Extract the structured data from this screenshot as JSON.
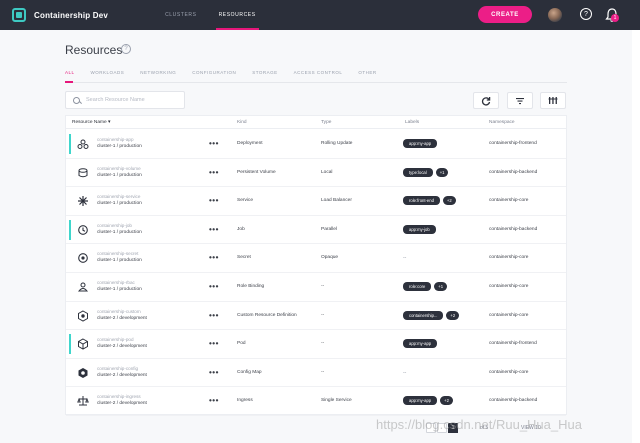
{
  "topbar": {
    "brand": "Containership Dev",
    "nav": [
      "CLUSTERS",
      "RESOURCES"
    ],
    "active_nav": 1,
    "create_label": "CREATE",
    "help_glyph": "?",
    "notification_count": "1",
    "accent": "#ec1e87"
  },
  "page": {
    "title": "Resources",
    "help_glyph": "?"
  },
  "tabs": [
    "ALL",
    "WORKLOADS",
    "NETWORKING",
    "CONFIGURATION",
    "STORAGE",
    "ACCESS CONTROL",
    "OTHER"
  ],
  "search": {
    "placeholder": "Search Resource Name"
  },
  "toolbar": {
    "refresh_icon": "refresh-icon",
    "filter_icon": "filter-icon",
    "columns_icon": "columns-icon"
  },
  "table": {
    "headers": {
      "name": "Resource Name",
      "kind": "Kind",
      "type": "Type",
      "labels": "Labels",
      "namespace": "Namespace"
    },
    "rows": [
      {
        "name": "containership-app",
        "cluster": "cluster-1 / production",
        "kind": "Deployment",
        "type": "Rolling Update",
        "label": "app:my-app",
        "extra": "",
        "namespace": "containership-frontend",
        "accent": true,
        "icon": "deployment-icon"
      },
      {
        "name": "containership-volume",
        "cluster": "cluster-1 / production",
        "kind": "Persistent Volume",
        "type": "Local",
        "label": "type:local",
        "extra": "+1",
        "namespace": "containership-backend",
        "accent": false,
        "icon": "volume-icon"
      },
      {
        "name": "containership-service",
        "cluster": "cluster-1 / production",
        "kind": "Service",
        "type": "Load Balancer",
        "label": "role:front-end",
        "extra": "+2",
        "namespace": "containership-core",
        "accent": false,
        "icon": "service-icon"
      },
      {
        "name": "containership-job",
        "cluster": "cluster-1 / production",
        "kind": "Job",
        "type": "Parallel",
        "label": "app:my-job",
        "extra": "",
        "namespace": "containership-backend",
        "accent": true,
        "icon": "job-icon"
      },
      {
        "name": "containership-secret",
        "cluster": "cluster-1 / production",
        "kind": "Secret",
        "type": "Opaque",
        "label": "",
        "extra": "",
        "namespace": "containership-core",
        "accent": false,
        "icon": "secret-icon"
      },
      {
        "name": "containership-rbac",
        "cluster": "cluster-1 / production",
        "kind": "Role Binding",
        "type": "--",
        "label": "role:core",
        "extra": "+1",
        "namespace": "containership-core",
        "accent": false,
        "icon": "role-binding-icon"
      },
      {
        "name": "containership-custom",
        "cluster": "cluster-2 / development",
        "kind": "Custom Resource Definition",
        "type": "--",
        "label": "containership...",
        "extra": "+2",
        "namespace": "containership-core",
        "accent": false,
        "icon": "custom-resource-icon"
      },
      {
        "name": "containership-pod",
        "cluster": "cluster-2 / development",
        "kind": "Pod",
        "type": "--",
        "label": "app:my-app",
        "extra": "",
        "namespace": "containership-frontend",
        "accent": true,
        "icon": "pod-icon"
      },
      {
        "name": "containership-config",
        "cluster": "cluster-2 / development",
        "kind": "Config Map",
        "type": "--",
        "label": "",
        "extra": "",
        "namespace": "containership-core",
        "accent": false,
        "icon": "config-map-icon"
      },
      {
        "name": "containership-ingress",
        "cluster": "cluster-2 / development",
        "kind": "Ingress",
        "type": "Single Service",
        "label": "app:my-app",
        "extra": "+2",
        "namespace": "containership-backend",
        "accent": false,
        "icon": "ingress-icon"
      }
    ],
    "empty_label": "--"
  },
  "pagination": {
    "current": "1",
    "of_text": "of 5",
    "view_text": "VIEW 10"
  },
  "watermark": "https://blog.csdn.net/Ruu_Hua_Hua"
}
